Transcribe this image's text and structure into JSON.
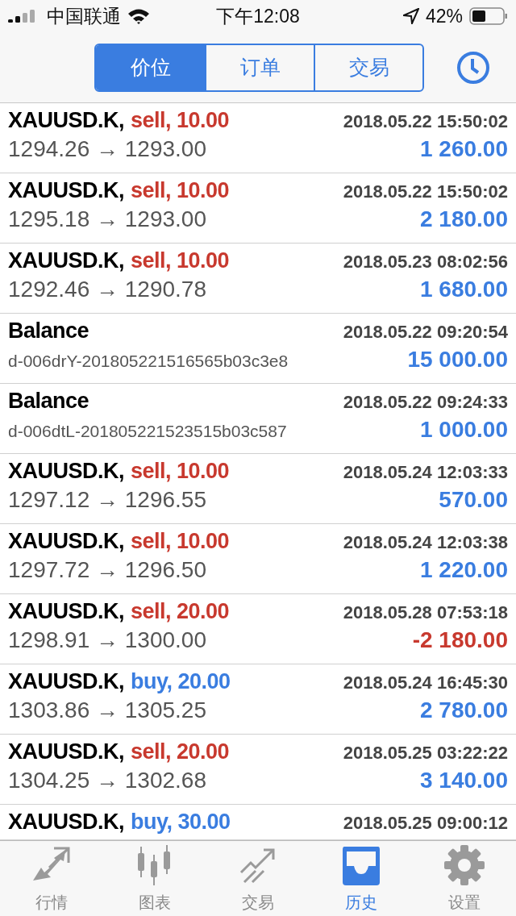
{
  "status_bar": {
    "carrier": "中国联通",
    "time": "下午12:08",
    "battery": "42%"
  },
  "segments": [
    {
      "label": "价位",
      "selected": true
    },
    {
      "label": "订单",
      "selected": false
    },
    {
      "label": "交易",
      "selected": false
    }
  ],
  "rows": [
    {
      "kind": "trade",
      "symbol": "XAUUSD.K,",
      "order": "sell, 10.00",
      "color": "#c8392e",
      "time": "2018.05.22 15:50:02",
      "prices": "1294.26 → 1293.00",
      "profit": "1 260.00",
      "loss": false
    },
    {
      "kind": "trade",
      "symbol": "XAUUSD.K,",
      "order": "sell, 10.00",
      "color": "#c8392e",
      "time": "2018.05.22 15:50:02",
      "prices": "1295.18 → 1293.00",
      "profit": "2 180.00",
      "loss": false
    },
    {
      "kind": "trade",
      "symbol": "XAUUSD.K,",
      "order": "sell, 10.00",
      "color": "#c8392e",
      "time": "2018.05.23 08:02:56",
      "prices": "1292.46 → 1290.78",
      "profit": "1 680.00",
      "loss": false
    },
    {
      "kind": "balance",
      "symbol": "Balance",
      "time": "2018.05.22 09:20:54",
      "comment": "d-006drY-201805221516565b03c3e8",
      "profit": "15 000.00",
      "loss": false
    },
    {
      "kind": "balance",
      "symbol": "Balance",
      "time": "2018.05.22 09:24:33",
      "comment": "d-006dtL-201805221523515b03c587",
      "profit": "1 000.00",
      "loss": false
    },
    {
      "kind": "trade",
      "symbol": "XAUUSD.K,",
      "order": "sell, 10.00",
      "color": "#c8392e",
      "time": "2018.05.24 12:03:33",
      "prices": "1297.12 → 1296.55",
      "profit": "570.00",
      "loss": false
    },
    {
      "kind": "trade",
      "symbol": "XAUUSD.K,",
      "order": "sell, 10.00",
      "color": "#c8392e",
      "time": "2018.05.24 12:03:38",
      "prices": "1297.72 → 1296.50",
      "profit": "1 220.00",
      "loss": false
    },
    {
      "kind": "trade",
      "symbol": "XAUUSD.K,",
      "order": "sell, 20.00",
      "color": "#c8392e",
      "time": "2018.05.28 07:53:18",
      "prices": "1298.91 → 1300.00",
      "profit": "-2 180.00",
      "loss": true
    },
    {
      "kind": "trade",
      "symbol": "XAUUSD.K,",
      "order": "buy, 20.00",
      "color": "#3a7de0",
      "time": "2018.05.24 16:45:30",
      "prices": "1303.86 → 1305.25",
      "profit": "2 780.00",
      "loss": false
    },
    {
      "kind": "trade",
      "symbol": "XAUUSD.K,",
      "order": "sell, 20.00",
      "color": "#c8392e",
      "time": "2018.05.25 03:22:22",
      "prices": "1304.25 → 1302.68",
      "profit": "3 140.00",
      "loss": false
    },
    {
      "kind": "partial",
      "symbol": "XAUUSD.K,",
      "order": "buy, 30.00",
      "color": "#3a7de0",
      "time": "2018.05.25 09:00:12"
    }
  ],
  "tab_bar": [
    {
      "kind": "quotes",
      "label": "行情",
      "selected": false
    },
    {
      "kind": "chart",
      "label": "图表",
      "selected": false
    },
    {
      "kind": "trade",
      "label": "交易",
      "selected": false
    },
    {
      "kind": "history",
      "label": "历史",
      "selected": true
    },
    {
      "kind": "settings",
      "label": "设置",
      "selected": false
    }
  ]
}
